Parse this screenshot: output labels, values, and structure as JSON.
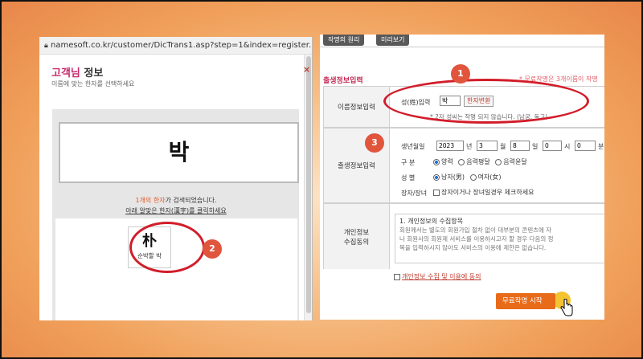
{
  "main": {
    "top_tabs": [
      "작명의 원리",
      "미리보기"
    ],
    "section_title": "출생정보입력",
    "section_note": "* 무료작명은 3개이름이 작명",
    "name_row": {
      "label": "이름정보입력",
      "field_label": "성(姓)입력",
      "surname_value": "박",
      "hanja_button": "한자변환",
      "note": "* 2자 성씨는 작명 되지 않습니다. (남궁, 독고)"
    },
    "birth_row": {
      "label": "출생정보입력",
      "date_label": "생년월일",
      "year": "2023",
      "year_unit": "년",
      "month": "3",
      "month_unit": "월",
      "day": "8",
      "day_unit": "일",
      "hour": "0",
      "hour_unit": "시",
      "minute": "0",
      "minute_unit": "분",
      "calendar_label": "구 분",
      "calendar_options": [
        "양력",
        "음력평달",
        "음력윤달"
      ],
      "gender_label": "성 별",
      "gender_options": [
        "남자(男)",
        "여자(女)"
      ],
      "disabled_label": "장자/장녀",
      "disabled_option": "장자이거나 장녀일경우 체크하세요"
    },
    "privacy_row": {
      "label_line1": "개인정보",
      "label_line2": "수집동의",
      "heading": "1. 개인정보의 수집항목",
      "line1": "회원께서는 별도의 회원가입 절차 없이 대부분의 콘텐츠에 자",
      "line2": "나 회원사의 회원제 서비스를 이용하시고자 할 경우 다음의 정",
      "line3": "목을 입력하시지 않아도 서비스의 이용에 제한은 없습니다.",
      "agree": "개인정보 수집 및 이용에 동의"
    },
    "start_button": "무료작명 시작"
  },
  "popup": {
    "url": "namesoft.co.kr/customer/DicTrans1.asp?step=1&index=register...",
    "title_a": "고객님",
    "title_b": " 정보",
    "subtitle": "이름에 맞는 한자를 선택하세요",
    "close": "×",
    "name_display": "박",
    "found_count": "1개의 한자",
    "found_suffix": "가 검색되었습니다.",
    "instruction": "아래 알맞은 한자(漢字)를 클릭하세요",
    "hanja": "朴",
    "hanja_reading": "순박할 박"
  },
  "annotations": [
    "1",
    "2",
    "3"
  ],
  "colors": {
    "accent": "#c8286b",
    "annotation": "#d21d2a",
    "button": "#e86b1a"
  }
}
